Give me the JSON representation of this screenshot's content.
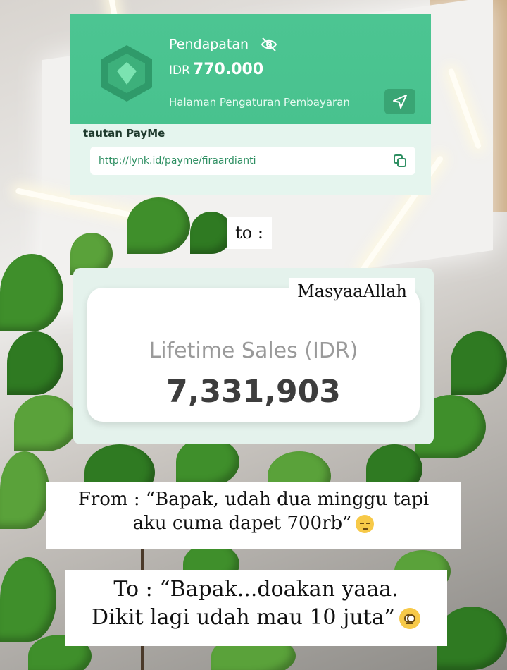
{
  "payment_card": {
    "title": "Pendapatan",
    "currency": "IDR",
    "amount": "770.000",
    "settings_link": "Halaman Pengaturan Pembayaran",
    "payme_label": "tautan PayMe",
    "payme_url": "http://lynk.id/payme/firaardianti",
    "icons": [
      "eye-off-icon",
      "send-icon",
      "copy-icon",
      "gem-icon"
    ],
    "accent": "#46c08c"
  },
  "caption_to": "to :",
  "sales_card": {
    "title": "Lifetime Sales (IDR)",
    "value": "7,331,903",
    "annotation": "MasyaaAllah"
  },
  "caption_from": {
    "line1": "From : “Bapak, udah dua minggu tapi",
    "line2": "aku cuma dapet 700rb”",
    "emoji": "pensive-face"
  },
  "caption_to_final": {
    "line1": "To : “Bapak...doakan yaaa.",
    "line2": "Dikit lagi udah mau 10 juta”",
    "emoji": "pleading-face"
  }
}
